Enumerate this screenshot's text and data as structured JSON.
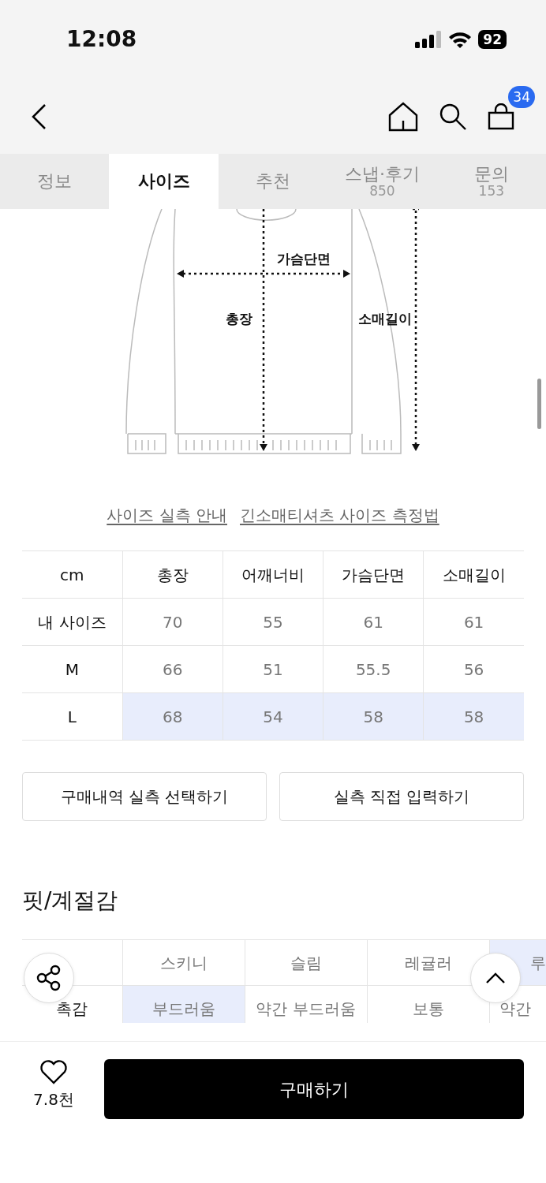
{
  "status_bar": {
    "time": "12:08",
    "battery": "92"
  },
  "header": {
    "cart_count": "34"
  },
  "tabs": [
    {
      "label": "정보",
      "selected": false
    },
    {
      "label": "사이즈",
      "selected": true
    },
    {
      "label": "추천",
      "selected": false
    },
    {
      "label": "스냅·후기",
      "count": "850",
      "selected": false
    },
    {
      "label": "문의",
      "count": "153",
      "selected": false
    }
  ],
  "diagram": {
    "labels": [
      "가슴단면",
      "총장",
      "소매길이"
    ]
  },
  "links": [
    "사이즈 실측 안내",
    "긴소매티셔츠 사이즈 측정법"
  ],
  "size_table": {
    "columns": [
      "cm",
      "총장",
      "어깨너비",
      "가슴단면",
      "소매길이"
    ],
    "rows": [
      {
        "cells": [
          "내 사이즈",
          "70",
          "55",
          "61",
          "61"
        ],
        "selected": false
      },
      {
        "cells": [
          "M",
          "66",
          "51",
          "55.5",
          "56"
        ],
        "selected": false
      },
      {
        "cells": [
          "L",
          "68",
          "54",
          "58",
          "58"
        ],
        "selected": true
      }
    ]
  },
  "size_buttons": [
    "구매내역 실측 선택하기",
    "실측 직접 입력하기"
  ],
  "fit_section": {
    "title": "핏/계절감",
    "rows": [
      {
        "options": [
          {
            "label": "스키니",
            "selected": false
          },
          {
            "label": "슬림",
            "selected": false
          },
          {
            "label": "레귤러",
            "selected": false
          },
          {
            "label": "루",
            "selected": true
          }
        ]
      },
      {
        "label": "촉감",
        "options": [
          {
            "label": "부드러움",
            "selected": true
          },
          {
            "label": "약간 부드러움",
            "selected": false
          },
          {
            "label": "보통",
            "selected": false
          },
          {
            "label": "약간",
            "selected": false
          }
        ]
      }
    ]
  },
  "bottom_bar": {
    "likes": "7.8천",
    "buy_button": "구매하기"
  }
}
